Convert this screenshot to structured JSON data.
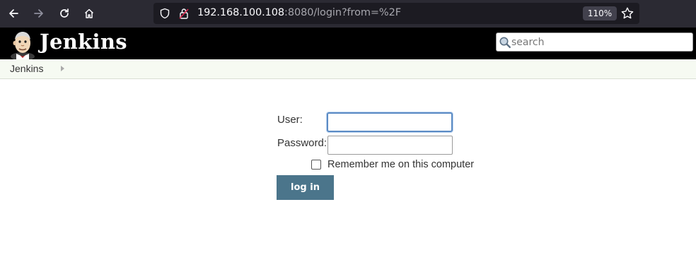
{
  "browser": {
    "url_host": "192.168.100.108",
    "url_rest": ":8080/login?from=%2F",
    "zoom": "110%",
    "icons": [
      "back-icon",
      "forward-icon",
      "reload-icon",
      "home-icon",
      "shield-icon",
      "lock-icon",
      "star-icon"
    ]
  },
  "header": {
    "logo_text": "Jenkins",
    "search_placeholder": "search"
  },
  "breadcrumb": {
    "items": [
      "Jenkins"
    ]
  },
  "login": {
    "user_label": "User:",
    "user_value": "",
    "password_label": "Password:",
    "password_value": "",
    "remember_label": "Remember me on this computer",
    "remember_checked": false,
    "submit_label": "log in"
  },
  "colors": {
    "browser_toolbar": "#2b2a33",
    "urlbar": "#1c1b22",
    "jenkins_header": "#000000",
    "breadcrumb_bg": "#f6faf2",
    "button_bg": "#4b758b",
    "focus_ring": "#5b8bc4"
  }
}
